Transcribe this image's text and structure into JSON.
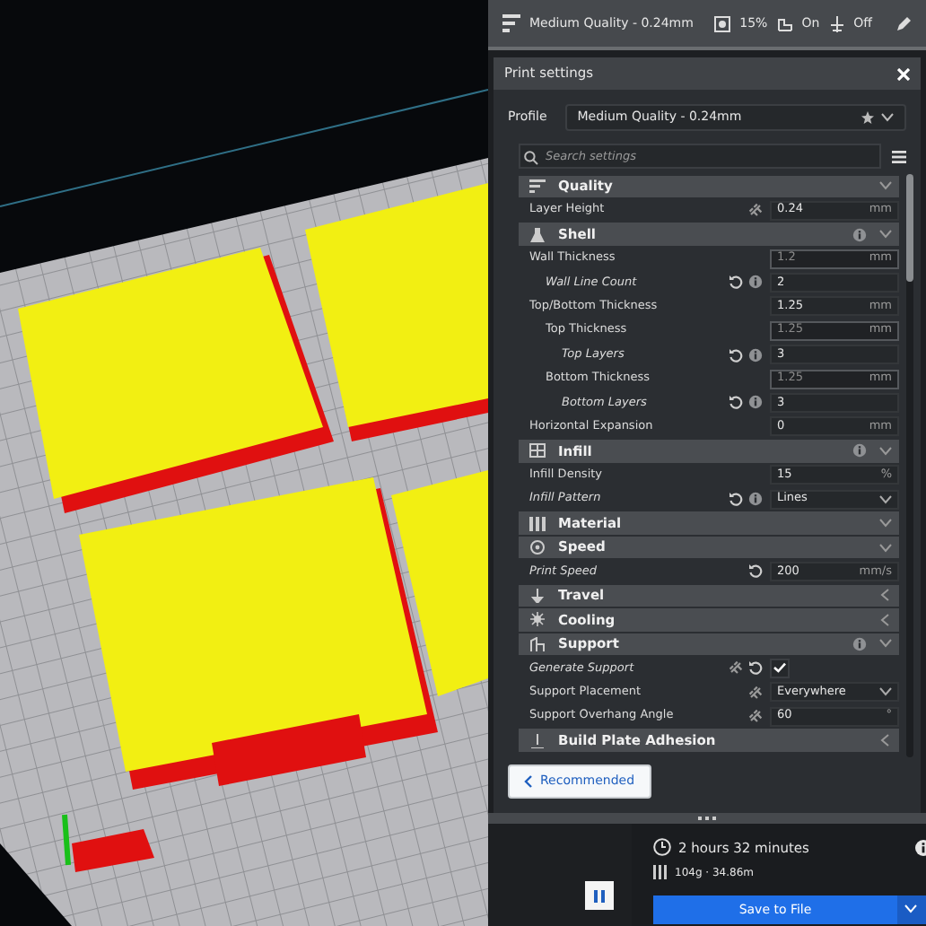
{
  "top_bar": {
    "profile": "Medium Quality - 0.24mm",
    "infill": "15%",
    "support": "On",
    "adhesion": "Off"
  },
  "panel": {
    "title": "Print settings",
    "profile_label": "Profile",
    "profile": "Medium Quality - 0.24mm",
    "search_placeholder": "Search settings"
  },
  "categories": [
    {
      "label": "Quality",
      "expanded": true,
      "settings": [
        {
          "label": "Layer Height",
          "linked": true,
          "kind": "field",
          "value": "0.24",
          "unit": "mm"
        }
      ]
    },
    {
      "label": "Shell",
      "expanded": true,
      "info": true,
      "settings": [
        {
          "label": "Wall Thickness",
          "kind": "field",
          "value": "1.2",
          "unit": "mm",
          "dimmed": true,
          "children": [
            {
              "label": "Wall Line Count",
              "changed": true,
              "resettable": true,
              "inherits": true,
              "kind": "field",
              "value": "2"
            }
          ]
        },
        {
          "label": "Top/Bottom Thickness",
          "kind": "field",
          "value": "1.25",
          "unit": "mm",
          "children": [
            {
              "label": "Top Thickness",
              "kind": "field",
              "value": "1.25",
              "unit": "mm",
              "dimmed": true,
              "children": [
                {
                  "label": "Top Layers",
                  "changed": true,
                  "resettable": true,
                  "inherits": true,
                  "kind": "field",
                  "value": "3"
                }
              ]
            },
            {
              "label": "Bottom Thickness",
              "kind": "field",
              "value": "1.25",
              "unit": "mm",
              "dimmed": true,
              "children": [
                {
                  "label": "Bottom Layers",
                  "changed": true,
                  "resettable": true,
                  "inherits": true,
                  "kind": "field",
                  "value": "3"
                }
              ]
            }
          ]
        },
        {
          "label": "Horizontal Expansion",
          "kind": "field",
          "value": "0",
          "unit": "mm"
        }
      ]
    },
    {
      "label": "Infill",
      "expanded": true,
      "info": true,
      "settings": [
        {
          "label": "Infill Density",
          "kind": "field",
          "value": "15",
          "unit": "%"
        },
        {
          "label": "Infill Pattern",
          "changed": true,
          "resettable": true,
          "inherits": true,
          "kind": "dropdown",
          "value": "Lines"
        }
      ]
    },
    {
      "label": "Material",
      "expanded": true
    },
    {
      "label": "Speed",
      "expanded": true,
      "settings": [
        {
          "label": "Print Speed",
          "changed": true,
          "resettable": true,
          "kind": "field",
          "value": "200",
          "unit": "mm/s"
        }
      ]
    },
    {
      "label": "Travel",
      "expanded": false
    },
    {
      "label": "Cooling",
      "expanded": false
    },
    {
      "label": "Support",
      "expanded": true,
      "info": true,
      "settings": [
        {
          "label": "Generate Support",
          "changed": true,
          "linked": true,
          "resettable": true,
          "kind": "checkbox",
          "checked": true
        },
        {
          "label": "Support Placement",
          "linked": true,
          "kind": "dropdown",
          "value": "Everywhere"
        },
        {
          "label": "Support Overhang Angle",
          "linked": true,
          "kind": "field",
          "value": "60",
          "unit": "°"
        }
      ]
    },
    {
      "label": "Build Plate Adhesion",
      "expanded": false
    }
  ],
  "recommended_button": "Recommended",
  "estimate": {
    "time": "2 hours 32 minutes",
    "material": "104g · 34.86m"
  },
  "save_button": "Save to File"
}
